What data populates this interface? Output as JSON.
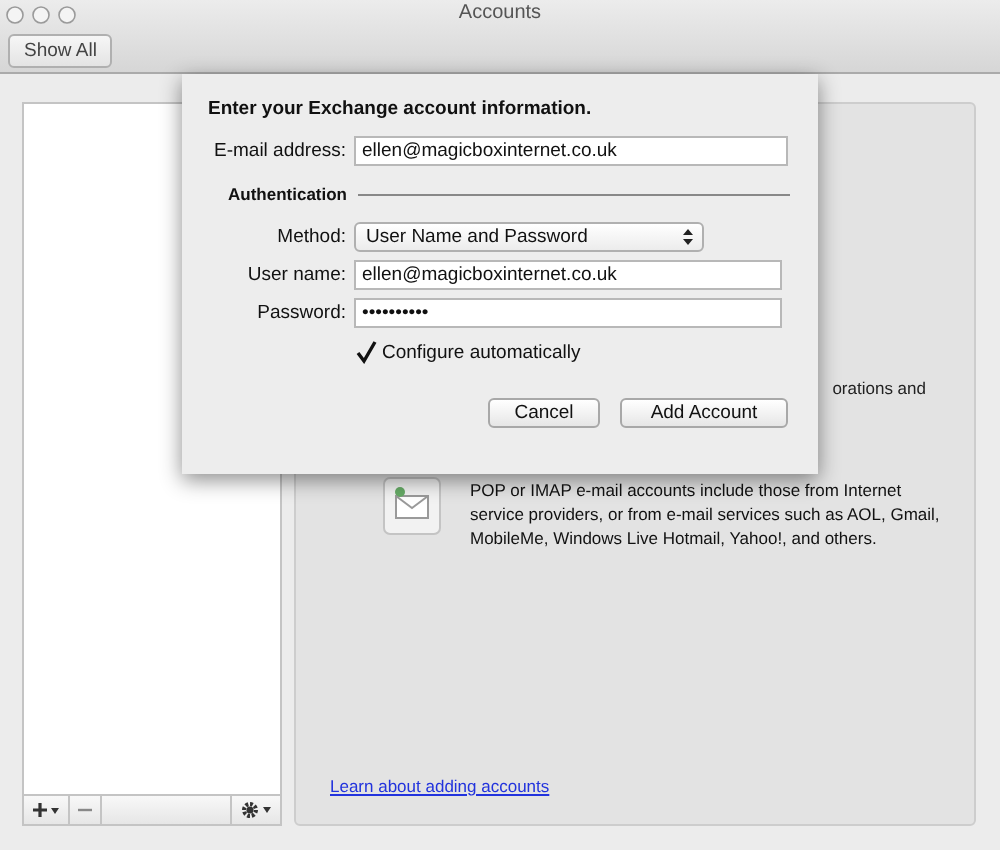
{
  "window": {
    "title": "Accounts"
  },
  "toolbar": {
    "show_all_button": "Show All"
  },
  "panel": {
    "exchange_description_fragment": "orations and",
    "email_account": {
      "description": "POP or IMAP e-mail accounts include those from Internet service providers, or from e-mail services such as AOL, Gmail, MobileMe, Windows Live Hotmail, Yahoo!, and others."
    },
    "learn_link": "Learn about adding accounts"
  },
  "sheet": {
    "heading": "Enter your Exchange account information.",
    "fields": [
      {
        "kind": "text",
        "label": "E-mail address:",
        "value": "ellen@magicboxinternet.co.uk"
      },
      {
        "kind": "section",
        "label": "Authentication"
      },
      {
        "kind": "popup",
        "label": "Method:",
        "value": "User Name and Password"
      },
      {
        "kind": "text",
        "label": "User name:",
        "value": "ellen@magicboxinternet.co.uk"
      },
      {
        "kind": "password",
        "label": "Password:",
        "value": "••••••••••"
      },
      {
        "kind": "checkbox",
        "label": "Configure automatically",
        "checked": true
      }
    ],
    "buttons": [
      "Cancel",
      "Add Account"
    ]
  }
}
